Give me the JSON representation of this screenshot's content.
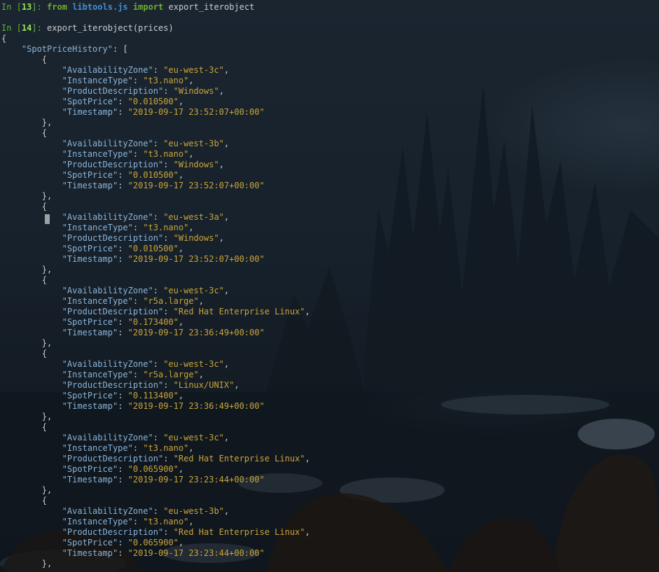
{
  "cells": [
    {
      "prompt_in": "In [",
      "number": "13",
      "prompt_close": "]: ",
      "kw_from": "from",
      "module": "libtools.js",
      "kw_import": "import",
      "name": "export_iterobject"
    },
    {
      "prompt_in": "In [",
      "number": "14",
      "prompt_close": "]: ",
      "code": "export_iterobject(prices)"
    }
  ],
  "output": {
    "open_brace": "{",
    "root_key": "\"SpotPriceHistory\"",
    "root_sep": ": [",
    "records": [
      {
        "AvailabilityZone": "\"eu-west-3c\"",
        "InstanceType": "\"t3.nano\"",
        "ProductDescription": "\"Windows\"",
        "SpotPrice": "\"0.010500\"",
        "Timestamp": "\"2019-09-17 23:52:07+00:00\""
      },
      {
        "AvailabilityZone": "\"eu-west-3b\"",
        "InstanceType": "\"t3.nano\"",
        "ProductDescription": "\"Windows\"",
        "SpotPrice": "\"0.010500\"",
        "Timestamp": "\"2019-09-17 23:52:07+00:00\""
      },
      {
        "AvailabilityZone": "\"eu-west-3a\"",
        "InstanceType": "\"t3.nano\"",
        "ProductDescription": "\"Windows\"",
        "SpotPrice": "\"0.010500\"",
        "Timestamp": "\"2019-09-17 23:52:07+00:00\""
      },
      {
        "AvailabilityZone": "\"eu-west-3c\"",
        "InstanceType": "\"r5a.large\"",
        "ProductDescription": "\"Red Hat Enterprise Linux\"",
        "SpotPrice": "\"0.173400\"",
        "Timestamp": "\"2019-09-17 23:36:49+00:00\""
      },
      {
        "AvailabilityZone": "\"eu-west-3c\"",
        "InstanceType": "\"r5a.large\"",
        "ProductDescription": "\"Linux/UNIX\"",
        "SpotPrice": "\"0.113400\"",
        "Timestamp": "\"2019-09-17 23:36:49+00:00\""
      },
      {
        "AvailabilityZone": "\"eu-west-3c\"",
        "InstanceType": "\"t3.nano\"",
        "ProductDescription": "\"Red Hat Enterprise Linux\"",
        "SpotPrice": "\"0.065900\"",
        "Timestamp": "\"2019-09-17 23:23:44+00:00\""
      },
      {
        "AvailabilityZone": "\"eu-west-3b\"",
        "InstanceType": "\"t3.nano\"",
        "ProductDescription": "\"Red Hat Enterprise Linux\"",
        "SpotPrice": "\"0.065900\"",
        "Timestamp": "\"2019-09-17 23:23:44+00:00\""
      }
    ],
    "field_order": [
      "AvailabilityZone",
      "InstanceType",
      "ProductDescription",
      "SpotPrice",
      "Timestamp"
    ],
    "record_open": "{",
    "record_close": "},",
    "trailing": "},"
  },
  "colors": {
    "prompt": "#5fae3a",
    "keyword": "#6fae2e",
    "module": "#3f8fd6",
    "json_key": "#8ab4d8",
    "json_string": "#c9a43a",
    "text": "#c8ccd0"
  },
  "icons": {
    "cursor": "block-cursor"
  }
}
